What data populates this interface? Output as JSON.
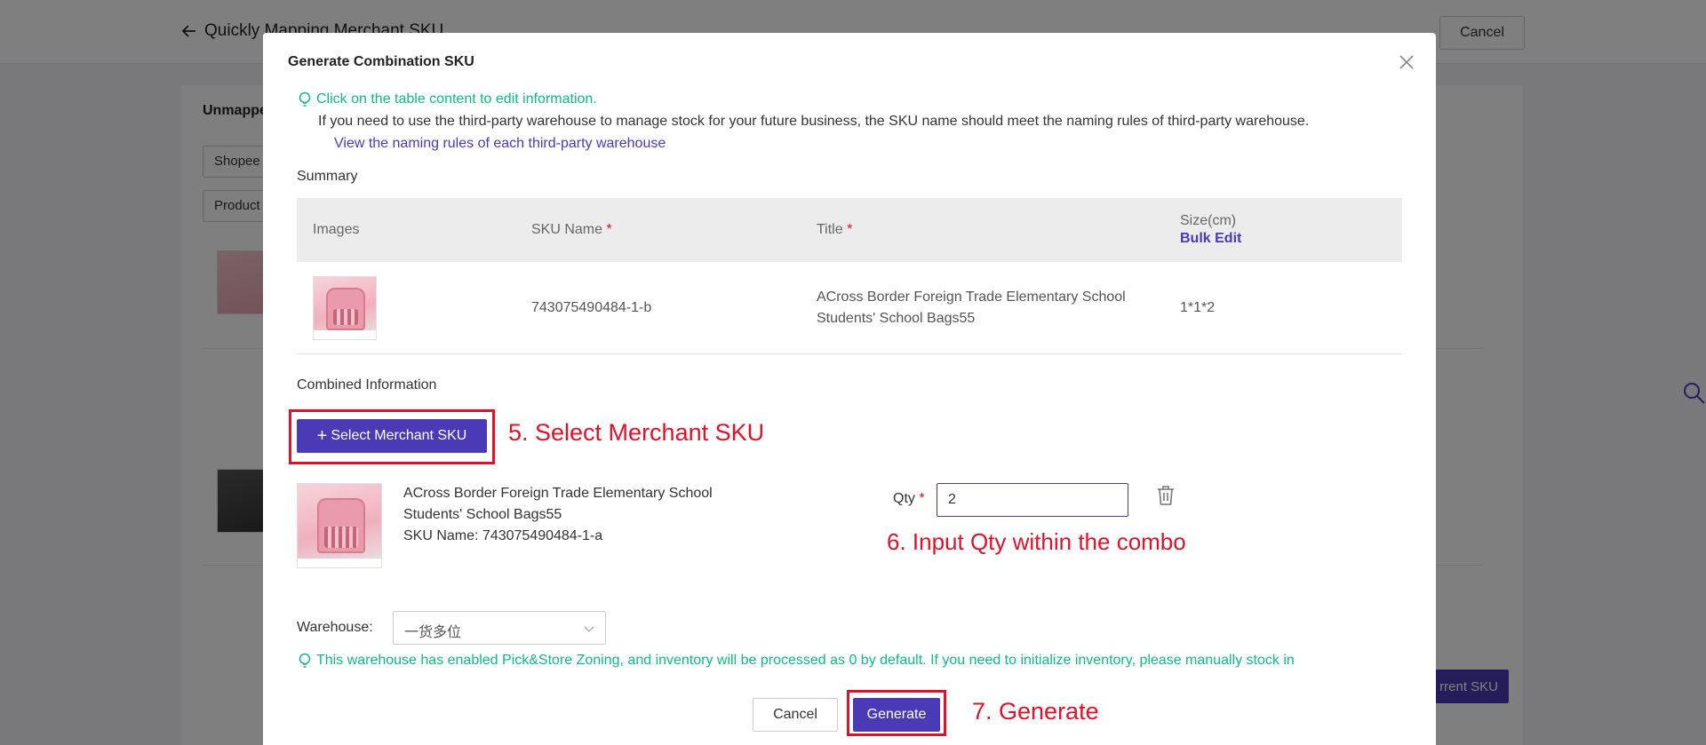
{
  "background": {
    "page_title": "Quickly Mapping Merchant SKU",
    "cancel_label": "Cancel",
    "card_title": "Unmapped",
    "filter_1": "Shopee",
    "filter_2": "Product",
    "current_sku_button": "rrent SKU"
  },
  "modal": {
    "title": "Generate Combination SKU",
    "tip": "Click on the table content to edit information.",
    "info": "If you need to use the third-party warehouse to manage stock for your future business, the SKU name should meet the naming rules of third-party warehouse.",
    "rules_link": "View the naming rules of each third-party warehouse",
    "summary_label": "Summary",
    "table": {
      "headers": {
        "images": "Images",
        "sku_name": "SKU Name",
        "title": "Title",
        "size": "Size(cm)",
        "bulk_edit": "Bulk Edit",
        "required_mark": "*"
      },
      "row": {
        "sku_name": "743075490484-1-b",
        "title_line1": "ACross Border Foreign Trade Elementary School",
        "title_line2": "Students' School Bags55",
        "size": "1*1*2"
      }
    },
    "combined_label": "Combined Information",
    "select_button": "Select Merchant SKU",
    "combo_item": {
      "title_line1": "ACross Border Foreign Trade Elementary School",
      "title_line2": "Students' School Bags55",
      "sku_line": "SKU Name: 743075490484-1-a",
      "qty_label": "Qty",
      "qty_required": "*",
      "qty_value": "2"
    },
    "warehouse_label": "Warehouse:",
    "warehouse_value": "一货多位",
    "warehouse_tip": "This warehouse has enabled Pick&Store Zoning, and inventory will be processed as 0 by default. If you need to initialize inventory, please manually stock in",
    "cancel_button": "Cancel",
    "generate_button": "Generate"
  },
  "annotations": {
    "step5": "5. Select Merchant SKU",
    "step6": "6. Input Qty within the combo",
    "step7": "7. Generate"
  },
  "colors": {
    "primary": "#4a3ab5",
    "tip_green": "#12b886",
    "annotation_red": "#e0112b"
  }
}
